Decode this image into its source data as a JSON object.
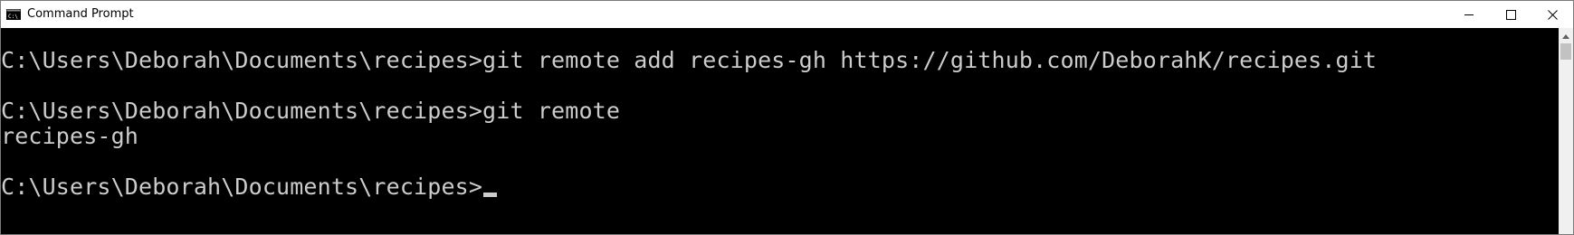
{
  "window": {
    "title": "Command Prompt",
    "app_icon": "cmd-icon",
    "controls": {
      "minimize_icon": "minimize-icon",
      "maximize_icon": "maximize-icon",
      "close_icon": "close-icon"
    }
  },
  "console": {
    "background": "#000000",
    "foreground": "#cccccc",
    "lines": [
      "C:\\Users\\Deborah\\Documents\\recipes>git remote add recipes-gh https://github.com/DeborahK/recipes.git",
      "C:\\Users\\Deborah\\Documents\\recipes>git remote",
      "recipes-gh",
      "C:\\Users\\Deborah\\Documents\\recipes>"
    ]
  },
  "scrollbar": {
    "up_icon": "scroll-up-arrow-icon"
  }
}
